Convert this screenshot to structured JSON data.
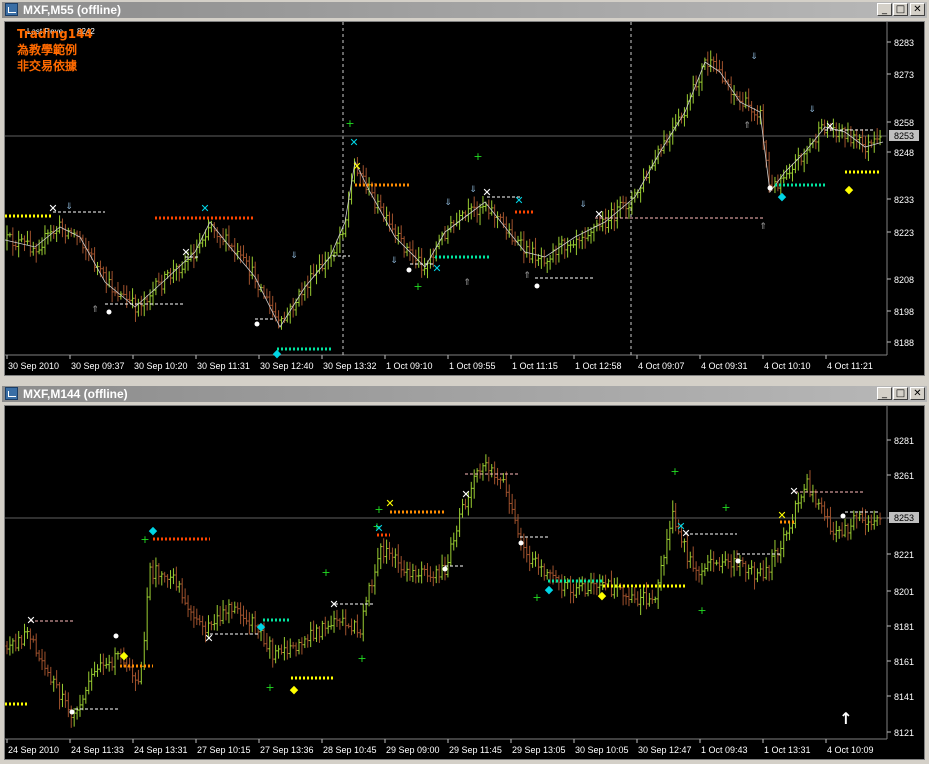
{
  "windows": {
    "top": {
      "title": "MXF,M55 (offline)"
    },
    "bottom": {
      "title": "MXF,M144 (offline)"
    }
  },
  "controls": {
    "minimize": "_",
    "restore": "□",
    "close": "✕"
  },
  "top_chart": {
    "watermark": [
      "Trading144",
      "為教學範例",
      "非交易依據"
    ],
    "last_rev_label": "Last Reve",
    "last_rev_value": "8242",
    "current_price": "8253",
    "price_ticks": [
      "8283",
      "8273",
      "8258",
      "8248",
      "8233",
      "8223",
      "8208",
      "8198",
      "8188"
    ],
    "time_labels": [
      "30 Sep 2010",
      "30 Sep 09:37",
      "30 Sep 10:20",
      "30 Sep 11:31",
      "30 Sep 12:40",
      "30 Sep 13:32",
      "1 Oct 09:10",
      "1 Oct 09:55",
      "1 Oct 11:15",
      "1 Oct 12:58",
      "4 Oct 09:07",
      "4 Oct 09:31",
      "4 Oct 10:10",
      "4 Oct 11:21"
    ]
  },
  "bottom_chart": {
    "current_price": "8253",
    "price_ticks": [
      "8281",
      "8261",
      "8241",
      "8221",
      "8201",
      "8181",
      "8161",
      "8141",
      "8121"
    ],
    "time_labels": [
      "24 Sep 2010",
      "24 Sep 11:33",
      "24 Sep 13:31",
      "27 Sep 10:15",
      "27 Sep 13:36",
      "28 Sep 10:45",
      "29 Sep 09:00",
      "29 Sep 11:45",
      "29 Sep 13:05",
      "30 Sep 10:05",
      "30 Sep 12:47",
      "1 Oct 09:43",
      "1 Oct 13:31",
      "4 Oct 10:09"
    ]
  },
  "colors": {
    "bull": "#9acd32",
    "bear": "#a0522d",
    "watermark": "#ff6a00",
    "axis_text": "#ffffff",
    "dots_yellow": "#ffff00",
    "dots_orange": "#ff8c00",
    "dots_red": "#ff4500",
    "dots_teal": "#00e5a0",
    "cyan": "#00d5e5",
    "green": "#22dd22"
  }
}
